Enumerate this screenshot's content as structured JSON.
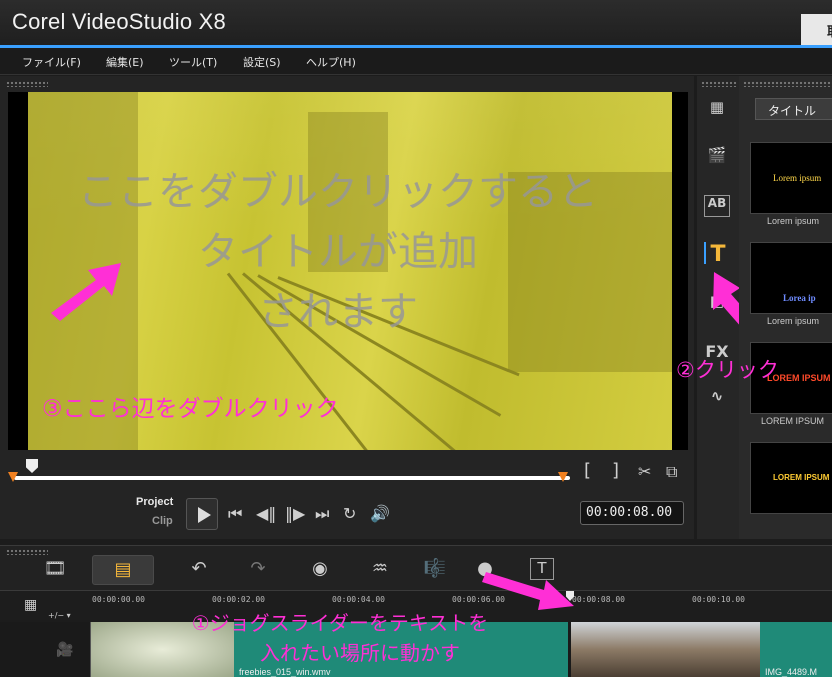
{
  "app": {
    "title": "Corel VideoStudio X8",
    "capture_tab": "取"
  },
  "menu": [
    {
      "label": "ファイル(F)"
    },
    {
      "label": "編集(E)"
    },
    {
      "label": "ツール(T)"
    },
    {
      "label": "設定(S)"
    },
    {
      "label": "ヘルプ(H)"
    }
  ],
  "preview": {
    "overlay_lines": [
      "ここをダブルクリックすると",
      "タイトルが追加",
      "されます"
    ],
    "annotation": "③ここら辺をダブルクリック"
  },
  "player": {
    "mode_project": "Project",
    "mode_clip": "Clip",
    "timecode": "00:00:08.00",
    "bracket_in": "[",
    "bracket_out": "]"
  },
  "library": {
    "dropdown": "タイトル",
    "items": [
      {
        "label": "Lorem ipsum",
        "preview": "Lorem ipsum",
        "preview_color": "#ffd84a"
      },
      {
        "label": "Lorem ipsum",
        "preview": "Lorea ip",
        "preview_color": "#6f8cff"
      },
      {
        "label": "LOREM IPSUM",
        "preview": "LOREM IPSUM",
        "preview_color": "#ff4a2a"
      },
      {
        "label": "",
        "preview": "LOREM IPSUM",
        "preview_color": "#ffcc33"
      }
    ],
    "annotation": "②クリック",
    "side_icons": [
      "media-icon",
      "instant-project-icon",
      "transition-icon",
      "title-icon",
      "graphic-icon",
      "filter-icon",
      "path-icon"
    ]
  },
  "timeline": {
    "ruler": [
      "00:00:00.00",
      "00:00:02.00",
      "00:00:04.00",
      "00:00:06.00",
      "00:00:08.00",
      "00:00:10.00"
    ],
    "clip1_label": "freebies_015_win.wmv",
    "clip2_label": "IMG_4489.M",
    "annotation_lines": [
      "①ジョグスライダーをテキストを",
      "入れたい場所に動かす"
    ]
  },
  "colors": {
    "accent": "#3aa0ff",
    "annotation": "#ff2fd6",
    "clip": "#1f8a78"
  }
}
